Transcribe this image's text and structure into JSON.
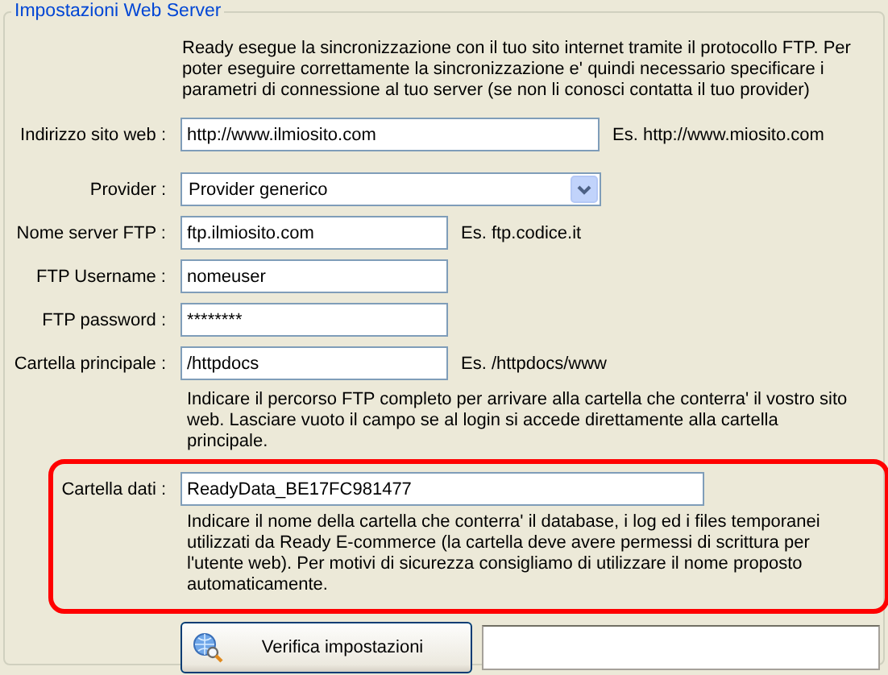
{
  "group": {
    "title": "Impostazioni Web Server",
    "intro": "Ready esegue la sincronizzazione con il tuo sito internet tramite il protocollo FTP. Per poter eseguire correttamente la sincronizzazione e' quindi necessario specificare i parametri di connessione al tuo server (se non li conosci contatta il tuo provider)",
    "fields": [
      {
        "label": "Indirizzo sito web :",
        "kind": "text",
        "value": "http://www.ilmiosito.com",
        "example": "Es. http://www.miosito.com"
      },
      {
        "label": "Provider :",
        "kind": "dropdown",
        "value": "Provider generico"
      },
      {
        "label": "Nome server FTP :",
        "kind": "text",
        "value": "ftp.ilmiosito.com",
        "example": "Es. ftp.codice.it"
      },
      {
        "label": "FTP Username :",
        "kind": "text",
        "value": "nomeuser"
      },
      {
        "label": "FTP password :",
        "kind": "text",
        "value": "********"
      },
      {
        "label": "Cartella principale :",
        "kind": "text",
        "value": "/httpdocs",
        "example": "Es. /httpdocs/www",
        "help": "Indicare il percorso FTP completo per arrivare alla cartella che conterra' il vostro sito web. Lasciare vuoto il campo se al login si accede direttamente alla cartella principale."
      }
    ],
    "data_folder": {
      "label": "Cartella dati :",
      "value": "ReadyData_BE17FC981477",
      "highlighted": true,
      "help": "Indicare il nome della cartella che conterra' il database, i log ed i files temporanei utilizzati da Ready E-commerce (la cartella deve avere permessi di scrittura per l'utente web). Per motivi di sicurezza consigliamo di utilizzare il nome proposto automaticamente."
    },
    "verify_button": {
      "label": "Verifica impostazioni"
    }
  }
}
